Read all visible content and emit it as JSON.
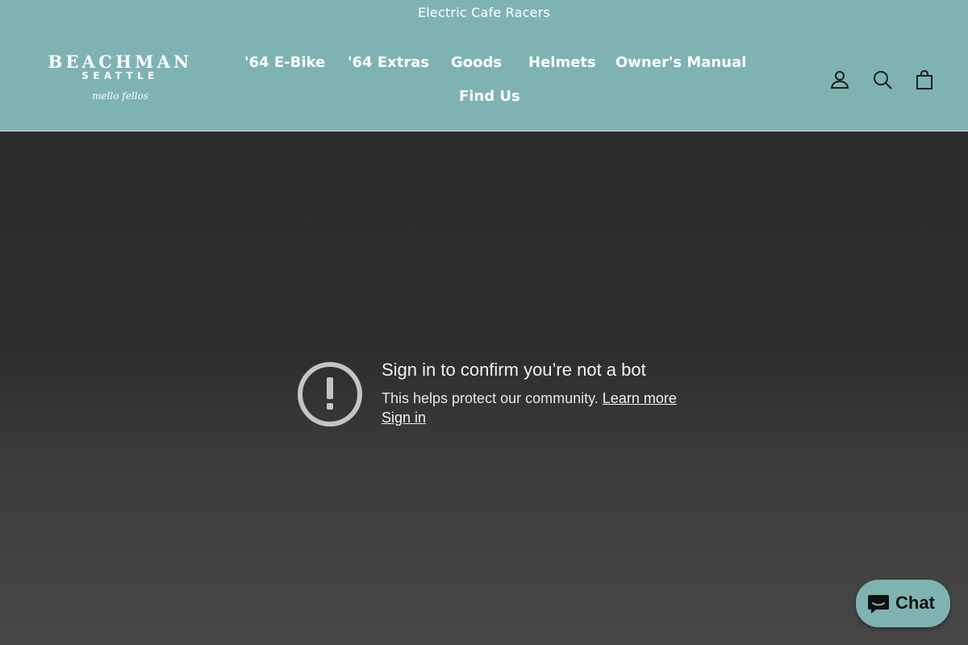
{
  "announcement": {
    "text": "Electric Cafe Racers"
  },
  "logo": {
    "main": "BEACHMAN",
    "sub": "SEATTLE",
    "script": "mello fellos"
  },
  "nav": {
    "items": [
      {
        "label": "'64 E-Bike"
      },
      {
        "label": "'64 Extras"
      },
      {
        "label": "Goods"
      },
      {
        "label": "Helmets"
      },
      {
        "label": "Owner's Manual"
      },
      {
        "label": "Find Us"
      }
    ]
  },
  "header_icons": {
    "account": "account-icon",
    "search": "search-icon",
    "cart": "cart-icon"
  },
  "message": {
    "title": "Sign in to confirm you’re not a bot",
    "body": "This helps protect our community.",
    "learn_more": "Learn more",
    "sign_in": "Sign in"
  },
  "chat": {
    "label": "Chat"
  },
  "colors": {
    "header_bg": "#7fb3b2",
    "main_bg_top": "#2b2b2b",
    "main_bg_bottom": "#474747",
    "alert_icon": "#c4c4c4"
  }
}
